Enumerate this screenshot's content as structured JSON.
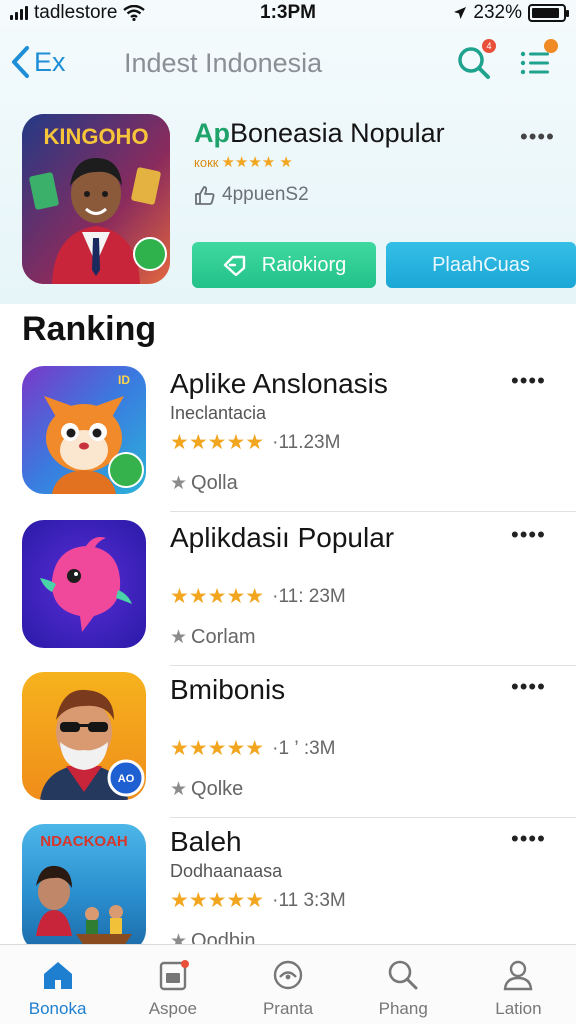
{
  "status_bar": {
    "carrier": "tadlestore",
    "time": "1:3PM",
    "battery": "232%",
    "battery_level": 0.9
  },
  "nav": {
    "back_label": "Ex",
    "title": "Indest Indonesia",
    "search_icon": "search-icon",
    "search_badge": "4",
    "list_icon": "list-icon"
  },
  "featured": {
    "icon_text": "KINGOHO",
    "title_prefix": "Ap",
    "title_rest": "Boneasia Nopular",
    "rating_text": "кокк",
    "stars": "★★★★ ★",
    "meta": "4ppuenS2",
    "more": "••••",
    "primary_button": "Raiokiorg",
    "secondary_button": "PlaahCuas"
  },
  "section_title": "Ranking",
  "apps": [
    {
      "name": "Aplike Anslonasis",
      "developer": "Ineclantacia",
      "stars": "★★★★★",
      "rating": 4.5,
      "downloads": "·11.23M",
      "tag": "Qolla",
      "more": "••••",
      "icon": "fox-mascot-icon"
    },
    {
      "name": "Aplikdasiı Popular",
      "developer": "",
      "stars": "★★★★★",
      "rating": 4.5,
      "downloads": "·11: 23M",
      "tag": "Corlam",
      "more": "••••",
      "icon": "pink-bird-icon"
    },
    {
      "name": "Bmibonis",
      "developer": "",
      "stars": "★★★★★",
      "rating": 4.5,
      "downloads": "·1 ’ :3M",
      "tag": "Qolke",
      "more": "••••",
      "icon": "bearded-man-icon"
    },
    {
      "name": "Baleh",
      "developer": "Dodhaanaasa",
      "stars": "★★★★★",
      "rating": 4.5,
      "downloads": "·11 3:3M",
      "tag": "Qodbin",
      "more": "••••",
      "icon": "boat-scene-icon"
    }
  ],
  "tabs": [
    {
      "label": "Bonoka",
      "icon": "home-icon",
      "active": true
    },
    {
      "label": "Aspoe",
      "icon": "apps-icon",
      "active": false
    },
    {
      "label": "Pranta",
      "icon": "games-icon",
      "active": false
    },
    {
      "label": "Phang",
      "icon": "search-icon",
      "active": false
    },
    {
      "label": "Lation",
      "icon": "profile-icon",
      "active": false
    }
  ],
  "colors": {
    "accent": "#1e8fd6",
    "green_button": "#22c28a",
    "blue_button": "#1aa7d6",
    "star": "#f2a51f"
  }
}
